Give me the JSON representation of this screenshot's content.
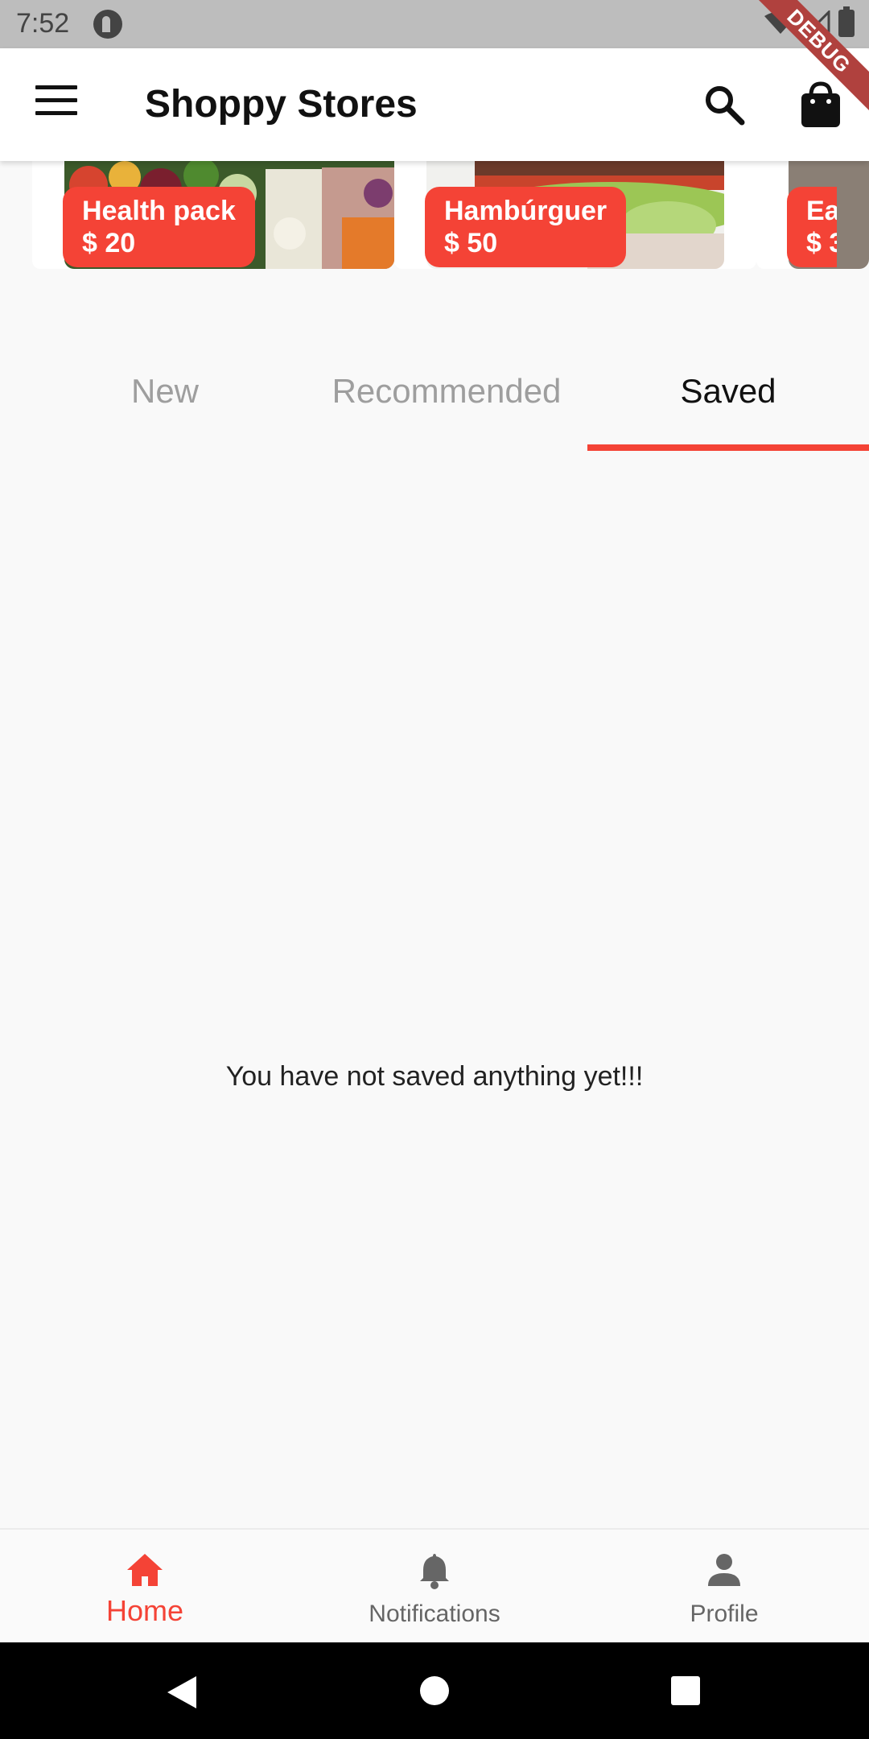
{
  "status_bar": {
    "time": "7:52"
  },
  "debug_banner": "DEBUG",
  "app_bar": {
    "title": "Shoppy Stores"
  },
  "carousel": {
    "items": [
      {
        "name": "Health pack",
        "price": "$ 20"
      },
      {
        "name": "Hambúrguer",
        "price": "$ 50"
      },
      {
        "name": "Ea",
        "price": "$ 3"
      }
    ]
  },
  "tabs": {
    "items": [
      {
        "label": "New"
      },
      {
        "label": "Recommended"
      },
      {
        "label": "Saved"
      }
    ],
    "active_index": 2
  },
  "saved": {
    "empty_message": "You have not saved anything yet!!!"
  },
  "bottom_nav": {
    "items": [
      {
        "label": "Home",
        "icon": "home-icon"
      },
      {
        "label": "Notifications",
        "icon": "bell-icon"
      },
      {
        "label": "Profile",
        "icon": "person-icon"
      }
    ],
    "active_index": 0
  },
  "colors": {
    "accent": "#f44336",
    "text": "#111111",
    "muted": "#9e9e9e",
    "background": "#f9f9f9"
  }
}
